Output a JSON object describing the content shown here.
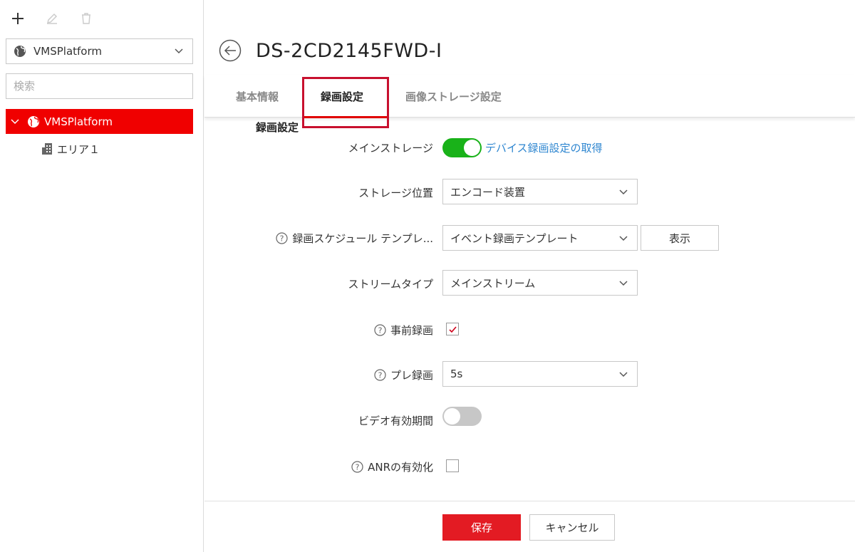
{
  "sidebar": {
    "site_select": {
      "value": "VMSPlatform"
    },
    "search": {
      "placeholder": "検索"
    },
    "tree": {
      "root_label": "VMSPlatform",
      "children": [
        {
          "label": "エリア１"
        }
      ]
    }
  },
  "header": {
    "title": "DS-2CD2145FWD-I"
  },
  "tabs": [
    {
      "label": "基本情報"
    },
    {
      "label": "録画設定"
    },
    {
      "label": "画像ストレージ設定"
    }
  ],
  "section": {
    "title": "録画設定",
    "main_storage": {
      "label": "メインストレージ",
      "enabled": true,
      "link": "デバイス録画設定の取得"
    },
    "storage_location": {
      "label": "ストレージ位置",
      "value": "エンコード装置"
    },
    "schedule_template": {
      "label": "録画スケジュール テンプレ...",
      "value": "イベント録画テンプレート",
      "show_button": "表示"
    },
    "stream_type": {
      "label": "ストリームタイプ",
      "value": "メインストリーム"
    },
    "pre_record": {
      "label": "事前録画",
      "checked": true
    },
    "pre_record_time": {
      "label": "プレ録画",
      "value": "5s"
    },
    "video_expiry": {
      "label": "ビデオ有効期間",
      "enabled": false
    },
    "anr": {
      "label": "ANRの有効化",
      "checked": false
    }
  },
  "footer": {
    "save": "保存",
    "cancel": "キャンセル"
  },
  "colors": {
    "accent": "#e31b23",
    "toggle_on": "#19b219",
    "link": "#2e86d0"
  }
}
